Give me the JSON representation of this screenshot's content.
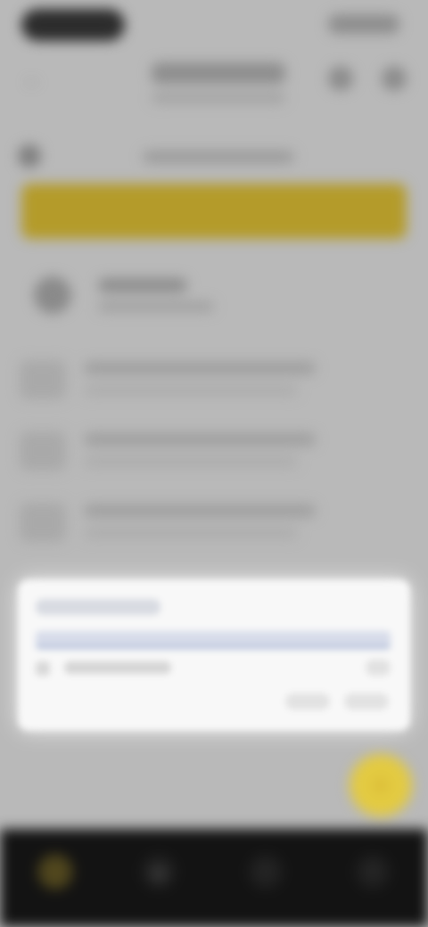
{
  "colors": {
    "background": "#b9b9b9",
    "accent": "#e3ca41",
    "banner": "#b49b2a",
    "dialog": "#f8f8f8",
    "bottom_nav": "#131313"
  },
  "icons": {
    "back": "arrow-left-icon",
    "action_1": "circle-icon",
    "action_2": "circle-icon",
    "fab": "plus-icon",
    "nav_1": "home-icon",
    "nav_2": "grid-icon",
    "nav_3": "bookmark-icon",
    "nav_4": "menu-icon"
  },
  "status_bar": {
    "pill_text": "",
    "right_text": ""
  },
  "app_bar": {
    "title": "",
    "subtitle": ""
  },
  "banner": {
    "text": ""
  },
  "section": {
    "title": "",
    "subtitle": ""
  },
  "list": {
    "items": [
      {
        "title": "",
        "subtitle": ""
      },
      {
        "title": "",
        "subtitle": ""
      },
      {
        "title": "",
        "subtitle": ""
      }
    ]
  },
  "dialog": {
    "title": "",
    "row_label": "",
    "action_1": "",
    "action_2": ""
  }
}
